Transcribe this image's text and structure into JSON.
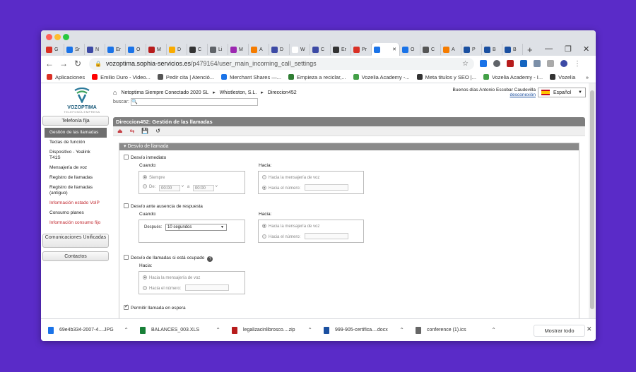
{
  "browser": {
    "tabs": [
      {
        "label": "G",
        "color": "#d93025"
      },
      {
        "label": "Sr",
        "color": "#1a73e8"
      },
      {
        "label": "N",
        "color": "#3c4aa5"
      },
      {
        "label": "Er",
        "color": "#1a73e8"
      },
      {
        "label": "O",
        "color": "#1a73e8"
      },
      {
        "label": "M",
        "color": "#b71c1c"
      },
      {
        "label": "D",
        "color": "#f9ab00"
      },
      {
        "label": "C",
        "color": "#333333"
      },
      {
        "label": "Li",
        "color": "#5f6368"
      },
      {
        "label": "M",
        "color": "#9c27b0"
      },
      {
        "label": "A",
        "color": "#f57c00"
      },
      {
        "label": "D",
        "color": "#3c4aa5"
      },
      {
        "label": "W",
        "color": "#ffffff"
      },
      {
        "label": "C",
        "color": "#3c4aa5"
      },
      {
        "label": "Er",
        "color": "#333333"
      },
      {
        "label": "Pr",
        "color": "#d93025"
      },
      {
        "label": "",
        "color": "#1a73e8",
        "active": true
      },
      {
        "label": "O",
        "color": "#1a73e8"
      },
      {
        "label": "C",
        "color": "#555555"
      },
      {
        "label": "A",
        "color": "#f57c00"
      },
      {
        "label": "P",
        "color": "#1a4fa0"
      },
      {
        "label": "B",
        "color": "#1a4fa0"
      },
      {
        "label": "B",
        "color": "#1a4fa0"
      }
    ],
    "url_host": "vozoptima.sophia-servicios.es",
    "url_path": "/p479164/user_main_incoming_call_settings",
    "bookmarks": [
      {
        "label": "Aplicaciones",
        "color": "#d93025"
      },
      {
        "label": "Emilio Duro - Video...",
        "color": "#ff0000"
      },
      {
        "label": "Pedir cita | Atenció...",
        "color": "#555555"
      },
      {
        "label": "Merchant Shares —...",
        "color": "#1a73e8"
      },
      {
        "label": "Empieza a reciclar,...",
        "color": "#2e7d32"
      },
      {
        "label": "Vozelia Academy -...",
        "color": "#43a047"
      },
      {
        "label": "Meta titulos y SEO |...",
        "color": "#333333"
      },
      {
        "label": "Vozelia Academy - I...",
        "color": "#43a047"
      },
      {
        "label": "Vozelia",
        "color": "#333333"
      }
    ],
    "more_bookmarks": "»"
  },
  "header": {
    "logo_name": "VOZOPTIMA",
    "logo_sub": "TELEFONÍA EMPRESA",
    "breadcrumb": [
      "Netoptima Siempre Conectado 2020 SL",
      "Whistleston, S.L.",
      "Direccion452"
    ],
    "search_label": "buscar:",
    "search_value": "",
    "greeting": "Buenos días Antonio Escobar Caudevilla",
    "logout": "desconexión",
    "language": "Español"
  },
  "sidebar": {
    "section1": "Telefonía fija",
    "items": [
      {
        "label": "Gestión de las llamadas",
        "active": true
      },
      {
        "label": "Teclas de función"
      },
      {
        "label": "Dispositivo - Yealink T41S"
      },
      {
        "label": "Mensajería de voz"
      },
      {
        "label": "Registro de llamadas"
      },
      {
        "label": "Registro de llamadas (antiguo)"
      },
      {
        "label": "Información estado VoIP",
        "red": true
      },
      {
        "label": "Consumo planes"
      },
      {
        "label": "Información consumo fijo",
        "red": true
      }
    ],
    "section2": "Comunicaciones Unificadas",
    "section3": "Contactos"
  },
  "main": {
    "title": "Direccion452: Gestión de las llamadas",
    "panel_title": "Desvío de llamada",
    "desvio_inmediato": "Desvío inmediato",
    "cuando": "Cuando:",
    "hacia": "Hacia:",
    "siempre": "Siempre",
    "de": "De:",
    "de_value": "00:00",
    "a": "a",
    "a_value": "00:00",
    "hacia_mensajeria": "Hacia la mensajería de voz",
    "hacia_numero": "Hacia el número:",
    "desvio_ausencia": "Desvío ante ausencia de respuesta",
    "despues": "Después:",
    "despues_value": "10 segundos",
    "desvio_ocupado": "Desvío de llamadas si está ocupado",
    "permitir_espera": "Permitir llamada en espera",
    "permitir_espera_checked": true
  },
  "downloads": [
    {
      "name": "69e4b334-2007-4....JPG",
      "color": "#1a73e8"
    },
    {
      "name": "BALANCES_003.XLS",
      "color": "#188038"
    },
    {
      "name": "legalizacinlibrosco....zip",
      "color": "#b71c1c"
    },
    {
      "name": "999-905-certifica....docx",
      "color": "#1a4fa0"
    },
    {
      "name": "conference (1).ics",
      "color": "#666666"
    }
  ],
  "show_all": "Mostrar todo"
}
